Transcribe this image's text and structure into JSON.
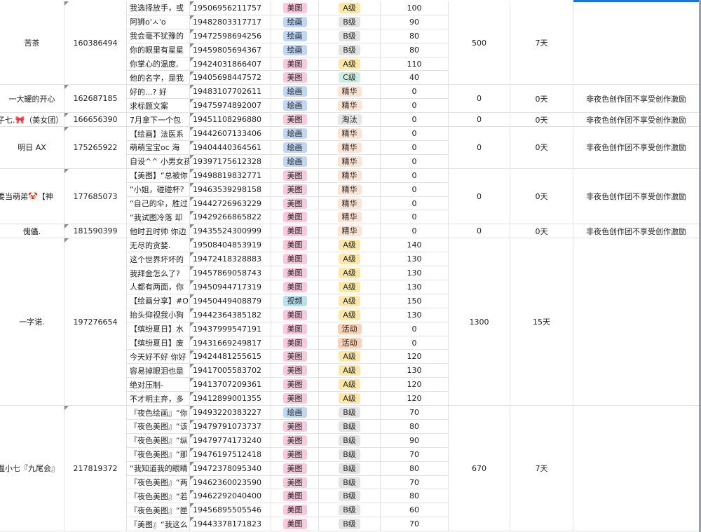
{
  "colors": {
    "美图": "#f8c9dc",
    "绘画": "#bfd7f7",
    "视频": "#b7e1f1",
    "A级": "#fde7a6",
    "B级": "#e3e3e3",
    "C级": "#cdeee0",
    "精华": "#fde3d2",
    "淘汰": "#e6e6e6",
    "活动": "#f9d2b6"
  },
  "groups": [
    {
      "name": "苦茶",
      "id": "160386494",
      "total": "500",
      "days": "7天",
      "note": "",
      "rows": [
        {
          "title": "我选择放手，或",
          "link": "19506956211757",
          "cat": "美图",
          "grade": "A级",
          "score": "100"
        },
        {
          "title": "阿狮o'ㅅ'o",
          "link": "19482803317717",
          "cat": "绘画",
          "grade": "B级",
          "score": "90"
        },
        {
          "title": "我会毫不犹豫的",
          "link": "19472598694256",
          "cat": "绘画",
          "grade": "B级",
          "score": "80"
        },
        {
          "title": "你的眼里有星星",
          "link": "19459805694367",
          "cat": "绘画",
          "grade": "B级",
          "score": "80"
        },
        {
          "title": "你掌心的温度,",
          "link": "19424031866407",
          "cat": "美图",
          "grade": "A级",
          "score": "110"
        },
        {
          "title": "他的名字，是我",
          "link": "19405698447572",
          "cat": "美图",
          "grade": "C级",
          "score": "40"
        }
      ]
    },
    {
      "name": "一大罐的开心",
      "id": "162687185",
      "total": "0",
      "days": "0天",
      "note": "非夜色创作团不享受创作激励",
      "rows": [
        {
          "title": "好的...? 好",
          "link": "19483107702611",
          "cat": "绘画",
          "grade": "精华",
          "score": "0"
        },
        {
          "title": "求标题文案",
          "link": "19475974892007",
          "cat": "绘画",
          "grade": "精华",
          "score": "0"
        }
      ]
    },
    {
      "name": "子七.🎀（美女团）",
      "id": "166656390",
      "total": "0",
      "days": "0天",
      "note": "非夜色创作团不享受创作激励",
      "rows": [
        {
          "title": "7月拿下一个包",
          "link": "19451108296880",
          "cat": "美图",
          "grade": "淘汰",
          "score": "0"
        }
      ]
    },
    {
      "name": "明日 AX",
      "id": "175265922",
      "total": "0",
      "days": "0天",
      "note": "非夜色创作团不享受创作激励",
      "rows": [
        {
          "title": "【绘画】法医系",
          "link": "19442607133406",
          "cat": "绘画",
          "grade": "精华",
          "score": "0"
        },
        {
          "title": "萌萌宝宝oc 海",
          "link": "19404440364561",
          "cat": "绘画",
          "grade": "精华",
          "score": "0"
        },
        {
          "title": "自设^^ 小男女孩",
          "link": "19397175612328",
          "cat": "绘画",
          "grade": "精华",
          "score": "0"
        }
      ]
    },
    {
      "name": "要当萌弟🤡【神",
      "id": "177685073",
      "total": "0",
      "days": "0天",
      "note": "非夜色创作团不享受创作激励",
      "rows": [
        {
          "title": "【美图】“总被你",
          "link": "19498819832771",
          "cat": "美图",
          "grade": "精华",
          "score": "0"
        },
        {
          "title": "“小姐，碰碰杯?",
          "link": "19463539298158",
          "cat": "美图",
          "grade": "精华",
          "score": "0"
        },
        {
          "title": "“自己的伞，胜过",
          "link": "19442726963229",
          "cat": "美图",
          "grade": "精华",
          "score": "0"
        },
        {
          "title": "“我试图冷落 却",
          "link": "19429266865822",
          "cat": "美图",
          "grade": "精华",
          "score": "0"
        }
      ]
    },
    {
      "name": "傀儡.",
      "id": "181590399",
      "total": "0",
      "days": "0天",
      "note": "非夜色创作团不享受创作激励",
      "rows": [
        {
          "title": "他时丑时帅 你边",
          "link": "19435524300999",
          "cat": "美图",
          "grade": "精华",
          "score": "0"
        }
      ]
    },
    {
      "name": "一字诺.",
      "id": "197276654",
      "total": "1300",
      "days": "15天",
      "note": "",
      "rows": [
        {
          "title": "无尽的贪婪.",
          "link": "19508404853919",
          "cat": "美图",
          "grade": "A级",
          "score": "140"
        },
        {
          "title": "这个世界坏坏的",
          "link": "19472418328883",
          "cat": "美图",
          "grade": "A级",
          "score": "130"
        },
        {
          "title": "我拜金怎么了?",
          "link": "19457869058743",
          "cat": "美图",
          "grade": "A级",
          "score": "130"
        },
        {
          "title": "人都有两面，你",
          "link": "19450944717319",
          "cat": "美图",
          "grade": "A级",
          "score": "130"
        },
        {
          "title": "【绘画分享】#O",
          "link": "19450449408879",
          "cat": "视频",
          "grade": "A级",
          "score": "150"
        },
        {
          "title": "抬头仰视我小狗",
          "link": "19442364385182",
          "cat": "美图",
          "grade": "A级",
          "score": "130"
        },
        {
          "title": "【缤纷夏日】水",
          "link": "19437999547191",
          "cat": "美图",
          "grade": "活动",
          "score": "0"
        },
        {
          "title": "【缤纷夏日】废",
          "link": "19431669249817",
          "cat": "美图",
          "grade": "活动",
          "score": "0"
        },
        {
          "title": "今天好不好 你好",
          "link": "19424481255615",
          "cat": "美图",
          "grade": "A级",
          "score": "120"
        },
        {
          "title": "容易掉眼泪也是",
          "link": "19417005583702",
          "cat": "美图",
          "grade": "A级",
          "score": "130"
        },
        {
          "title": "绝对压制-",
          "link": "19413707209361",
          "cat": "美图",
          "grade": "A级",
          "score": "120"
        },
        {
          "title": "不才明主弃，多",
          "link": "19412899001355",
          "cat": "美图",
          "grade": "A级",
          "score": "120"
        }
      ]
    },
    {
      "name": "温小七『九尾会』",
      "id": "217819372",
      "total": "670",
      "days": "7天",
      "note": "",
      "rows": [
        {
          "title": "『夜色绘画』“你",
          "link": "19493220383227",
          "cat": "绘画",
          "grade": "B级",
          "score": "70"
        },
        {
          "title": "『夜色美图』“该",
          "link": "19479791073737",
          "cat": "美图",
          "grade": "B级",
          "score": "80"
        },
        {
          "title": "『夜色美图』“纵",
          "link": "19479774173240",
          "cat": "美图",
          "grade": "B级",
          "score": "90"
        },
        {
          "title": "『夜色美图』“那",
          "link": "19476197512418",
          "cat": "美图",
          "grade": "B级",
          "score": "70"
        },
        {
          "title": "“我知道我的眼睛",
          "link": "19472378095340",
          "cat": "美图",
          "grade": "B级",
          "score": "80"
        },
        {
          "title": "『夜色美图』“两",
          "link": "19462360023590",
          "cat": "美图",
          "grade": "B级",
          "score": "70"
        },
        {
          "title": "『夜色美图』“若",
          "link": "19462292040400",
          "cat": "美图",
          "grade": "B级",
          "score": "80"
        },
        {
          "title": "『夜色美图』“匣",
          "link": "19456895505546",
          "cat": "美图",
          "grade": "B级",
          "score": "60"
        },
        {
          "title": "『美图』“我这么",
          "link": "19443378171823",
          "cat": "美图",
          "grade": "B级",
          "score": "70"
        }
      ]
    }
  ]
}
